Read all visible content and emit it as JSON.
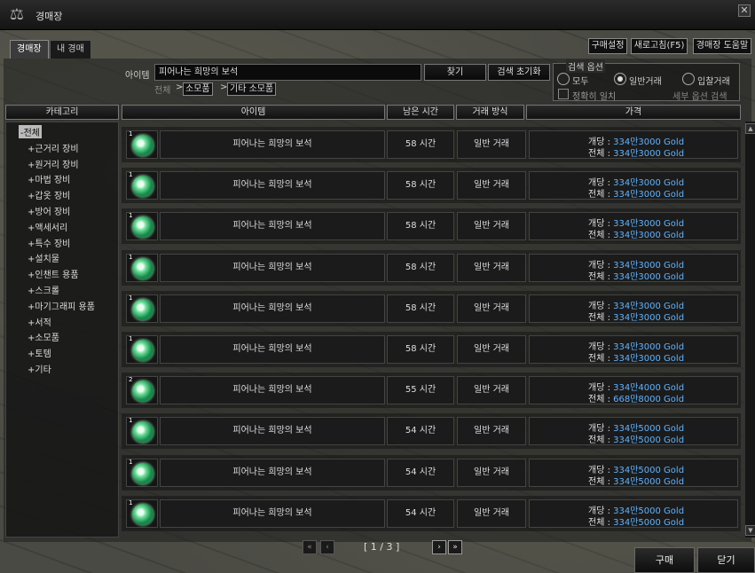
{
  "window": {
    "title": "경매장",
    "logo": "⚖",
    "close": "✕"
  },
  "tabs": [
    {
      "label": "경매장",
      "active": true
    },
    {
      "label": "내 경매",
      "active": false
    }
  ],
  "toolbar": {
    "settings": "구매설정",
    "refresh": "새로고침(F5)",
    "help": "경매장 도움말"
  },
  "search": {
    "item_label": "아이템",
    "value": "피어나는 희망의 보석",
    "find": "찾기",
    "reset": "검색 초기화",
    "breadcrumb": [
      "전체",
      "소모품",
      "기타 소모품"
    ],
    "sep": ">"
  },
  "search_options": {
    "title": "검색 옵션",
    "all": "모두",
    "normal": "일반거래",
    "bid": "입찰거래",
    "selected": "normal",
    "exact": "정확히 일치",
    "detail": "세부 옵션 검색"
  },
  "headers": {
    "category": "카테고리",
    "item": "아이템",
    "time": "남은 시간",
    "method": "거래 방식",
    "price": "가격"
  },
  "categories": [
    {
      "label": "-전체",
      "selected": true
    },
    {
      "label": "+근거리 장비",
      "selected": false
    },
    {
      "label": "+원거리 장비",
      "selected": false
    },
    {
      "label": "+마법 장비",
      "selected": false
    },
    {
      "label": "+갑옷 장비",
      "selected": false
    },
    {
      "label": "+방어 장비",
      "selected": false
    },
    {
      "label": "+액세서리",
      "selected": false
    },
    {
      "label": "+특수 장비",
      "selected": false
    },
    {
      "label": "+설치물",
      "selected": false
    },
    {
      "label": "+인챈트 용품",
      "selected": false
    },
    {
      "label": "+스크롤",
      "selected": false
    },
    {
      "label": "+마기그래피 용품",
      "selected": false
    },
    {
      "label": "+서적",
      "selected": false
    },
    {
      "label": "+소모품",
      "selected": false
    },
    {
      "label": "+토템",
      "selected": false
    },
    {
      "label": "+기타",
      "selected": false
    }
  ],
  "price_labels": {
    "each": "개당 :",
    "total": "전체 :"
  },
  "listings": [
    {
      "qty": "1",
      "name": "피어나는 희망의 보석",
      "time": "58 시간",
      "method": "일반 거래",
      "each": "334만3000 Gold",
      "total": "334만3000 Gold"
    },
    {
      "qty": "1",
      "name": "피어나는 희망의 보석",
      "time": "58 시간",
      "method": "일반 거래",
      "each": "334만3000 Gold",
      "total": "334만3000 Gold"
    },
    {
      "qty": "1",
      "name": "피어나는 희망의 보석",
      "time": "58 시간",
      "method": "일반 거래",
      "each": "334만3000 Gold",
      "total": "334만3000 Gold"
    },
    {
      "qty": "1",
      "name": "피어나는 희망의 보석",
      "time": "58 시간",
      "method": "일반 거래",
      "each": "334만3000 Gold",
      "total": "334만3000 Gold"
    },
    {
      "qty": "1",
      "name": "피어나는 희망의 보석",
      "time": "58 시간",
      "method": "일반 거래",
      "each": "334만3000 Gold",
      "total": "334만3000 Gold"
    },
    {
      "qty": "1",
      "name": "피어나는 희망의 보석",
      "time": "58 시간",
      "method": "일반 거래",
      "each": "334만3000 Gold",
      "total": "334만3000 Gold"
    },
    {
      "qty": "2",
      "name": "피어나는 희망의 보석",
      "time": "55 시간",
      "method": "일반 거래",
      "each": "334만4000 Gold",
      "total": "668만8000 Gold"
    },
    {
      "qty": "1",
      "name": "피어나는 희망의 보석",
      "time": "54 시간",
      "method": "일반 거래",
      "each": "334만5000 Gold",
      "total": "334만5000 Gold"
    },
    {
      "qty": "1",
      "name": "피어나는 희망의 보석",
      "time": "54 시간",
      "method": "일반 거래",
      "each": "334만5000 Gold",
      "total": "334만5000 Gold"
    },
    {
      "qty": "1",
      "name": "피어나는 희망의 보석",
      "time": "54 시간",
      "method": "일반 거래",
      "each": "334만5000 Gold",
      "total": "334만5000 Gold"
    }
  ],
  "pagination": {
    "text": "[ 1 / 3 ]",
    "first": "«",
    "prev": "‹",
    "next": "›",
    "last": "»"
  },
  "actions": {
    "buy": "구매",
    "close": "닫기"
  },
  "scrollbar": {
    "up": "▲",
    "down": "▼"
  }
}
